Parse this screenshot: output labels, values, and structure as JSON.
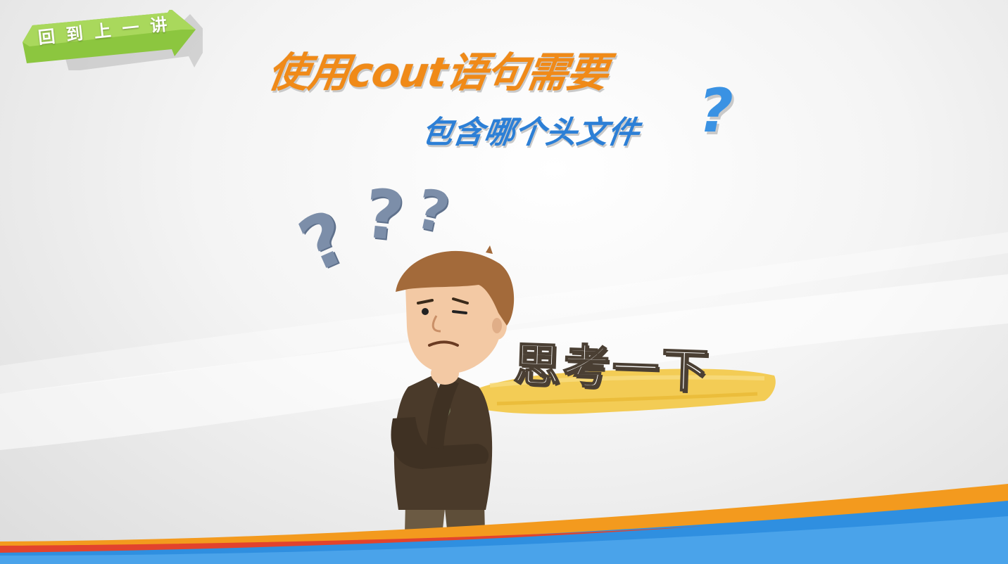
{
  "back_button": {
    "label": "回到上一讲",
    "fill_color": "#8cc63f"
  },
  "title": {
    "line1": "使用cout语句需要",
    "line2": "包含哪个头文件",
    "question_mark": "?",
    "line1_color": "#f08a18",
    "line2_color": "#2c7fd6"
  },
  "thinking": {
    "question_marks": [
      "?",
      "?",
      "?"
    ],
    "label": "思考一下",
    "brush_color": "#f2c94c"
  },
  "icons": [
    "back-arrow-icon",
    "thinking-man-illustration",
    "brush-stroke-icon"
  ],
  "colors": {
    "stripe_blue": "#2f8fe0",
    "stripe_orange": "#f39a1e",
    "stripe_red": "#e2432d",
    "suit_brown": "#4a3a2a"
  }
}
